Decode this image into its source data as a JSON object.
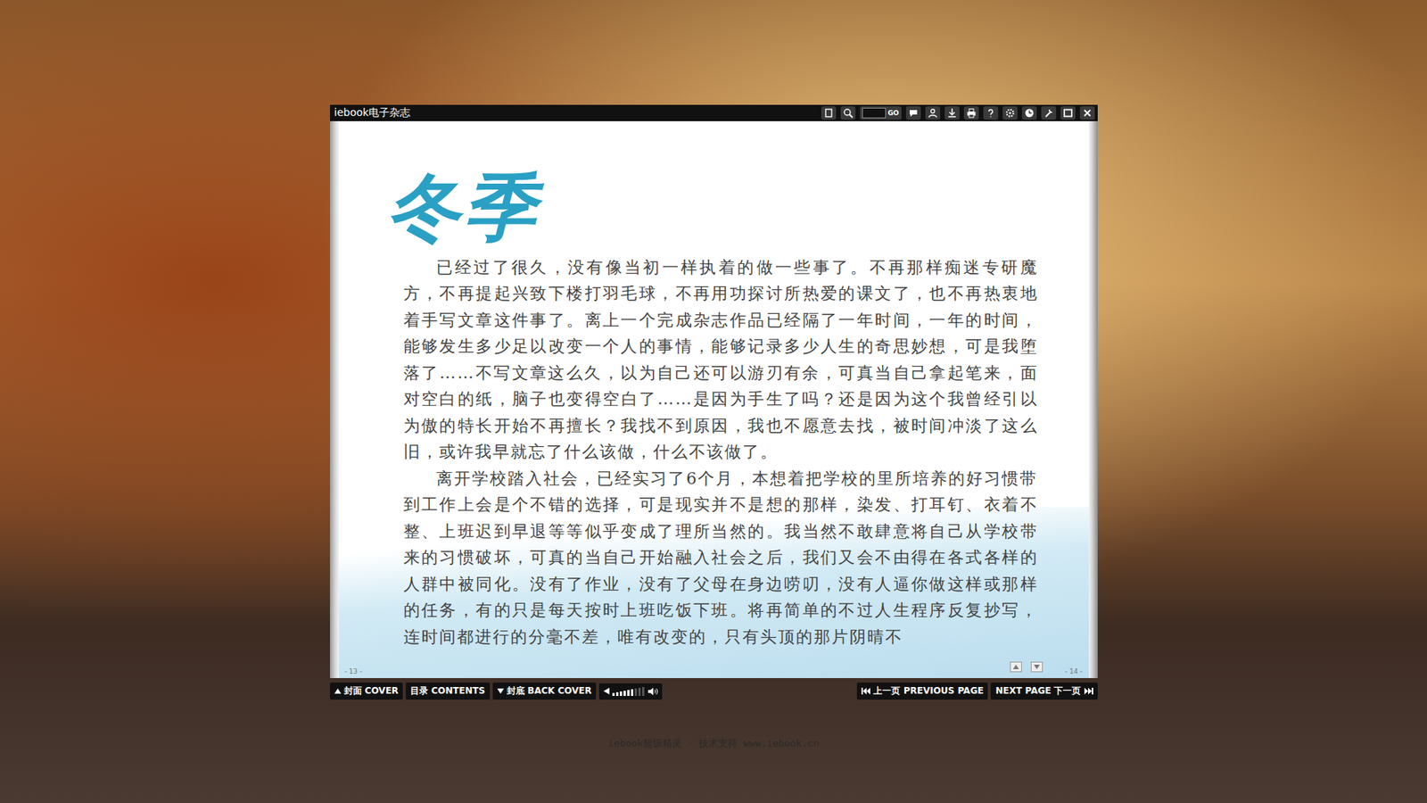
{
  "window": {
    "title": "iebook电子杂志"
  },
  "toolbar": {
    "page_field": "",
    "go_label": "GO"
  },
  "article": {
    "title": "冬季",
    "paragraphs": [
      "已经过了很久，没有像当初一样执着的做一些事了。不再那样痴迷专研魔方，不再提起兴致下楼打羽毛球，不再用功探讨所热爱的课文了，也不再热衷地着手写文章这件事了。离上一个完成杂志作品已经隔了一年时间，一年的时间，能够发生多少足以改变一个人的事情，能够记录多少人生的奇思妙想，可是我堕落了……不写文章这么久，以为自己还可以游刃有余，可真当自己拿起笔来，面对空白的纸，脑子也变得空白了……是因为手生了吗？还是因为这个我曾经引以为傲的特长开始不再擅长？我找不到原因，我也不愿意去找，被时间冲淡了这么旧，或许我早就忘了什么该做，什么不该做了。",
      "离开学校踏入社会，已经实习了6个月，本想着把学校的里所培养的好习惯带到工作上会是个不错的选择，可是现实并不是想的那样，染发、打耳钉、衣着不整、上班迟到早退等等似乎变成了理所当然的。我当然不敢肆意将自己从学校带来的习惯破坏，可真的当自己开始融入社会之后，我们又会不由得在各式各样的人群中被同化。没有了作业，没有了父母在身边唠叨，没有人逼你做这样或那样的任务，有的只是每天按时上班吃饭下班。将再简单的不过人生程序反复抄写，连时间都进行的分毫不差，唯有改变的，只有头顶的那片阴晴不"
    ]
  },
  "page_numbers": {
    "left": "- 13 -",
    "right": "- 14 -"
  },
  "nav": {
    "cover": "封面 COVER",
    "contents": "目录 CONTENTS",
    "back_cover": "封底 BACK COVER",
    "previous": "上一页 PREVIOUS PAGE",
    "next": "NEXT PAGE 下一页"
  },
  "volume": {
    "level": 0.7
  },
  "footer": "iebook超级精灵 · 技术支持 www.iebook.cn"
}
